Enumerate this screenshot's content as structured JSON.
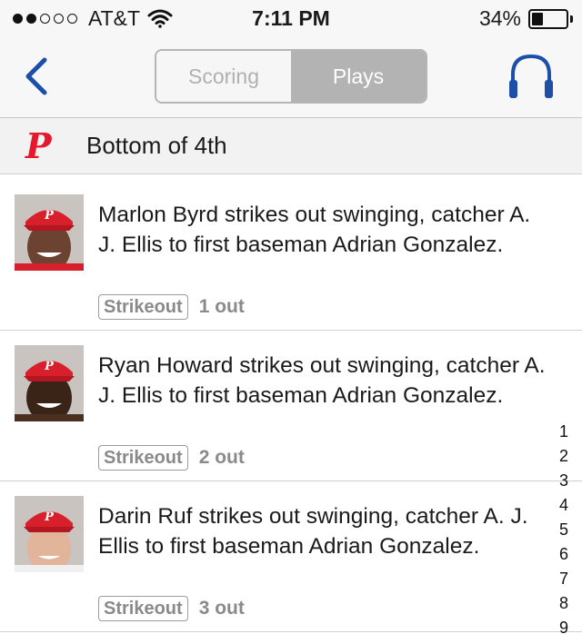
{
  "status_bar": {
    "carrier": "AT&T",
    "signal_dots_filled": 2,
    "signal_dots_total": 5,
    "time": "7:11 PM",
    "battery_percent": "34%",
    "battery_level": 0.34
  },
  "nav": {
    "back_icon": "chevron-left-icon",
    "tabs": [
      {
        "label": "Scoring",
        "active": false
      },
      {
        "label": "Plays",
        "active": true
      }
    ],
    "audio_icon": "headphones-icon",
    "accent_color": "#1e4fa8"
  },
  "inning": {
    "logo": "P",
    "logo_color": "#e8182c",
    "title": "Bottom of 4th"
  },
  "plays": [
    {
      "text": "Marlon Byrd strikes out swinging, catcher A.  J.   Ellis to first baseman Adrian Gonzalez.",
      "badge": "Strikeout",
      "outs": "1 out"
    },
    {
      "text": "Ryan Howard strikes out swinging, catcher A.  J.   Ellis to first baseman Adrian Gonzalez.",
      "badge": "Strikeout",
      "outs": "2 out"
    },
    {
      "text": "Darin Ruf strikes out swinging, catcher A.  J.   Ellis to first baseman Adrian Gonzalez.",
      "badge": "Strikeout",
      "outs": "3 out"
    }
  ],
  "index": [
    "1",
    "2",
    "3",
    "4",
    "5",
    "6",
    "7",
    "8",
    "9"
  ]
}
